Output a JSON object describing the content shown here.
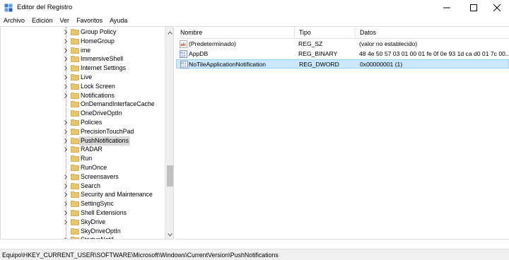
{
  "window": {
    "title": "Editor del Registro"
  },
  "menu": {
    "items": [
      "Archivo",
      "Edición",
      "Ver",
      "Favoritos",
      "Ayuda"
    ]
  },
  "tree": {
    "items": [
      {
        "label": "Group Policy",
        "expandable": true
      },
      {
        "label": "HomeGroup",
        "expandable": true
      },
      {
        "label": "ime",
        "expandable": true
      },
      {
        "label": "ImmersiveShell",
        "expandable": true
      },
      {
        "label": "Internet Settings",
        "expandable": true
      },
      {
        "label": "Live",
        "expandable": true
      },
      {
        "label": "Lock Screen",
        "expandable": true
      },
      {
        "label": "Notifications",
        "expandable": true
      },
      {
        "label": "OnDemandInterfaceCache",
        "expandable": false
      },
      {
        "label": "OneDriveOptIn",
        "expandable": false
      },
      {
        "label": "Policies",
        "expandable": true
      },
      {
        "label": "PrecisionTouchPad",
        "expandable": true
      },
      {
        "label": "PushNotifications",
        "expandable": true,
        "selected": true
      },
      {
        "label": "RADAR",
        "expandable": true
      },
      {
        "label": "Run",
        "expandable": false
      },
      {
        "label": "RunOnce",
        "expandable": false
      },
      {
        "label": "Screensavers",
        "expandable": true
      },
      {
        "label": "Search",
        "expandable": true
      },
      {
        "label": "Security and Maintenance",
        "expandable": true
      },
      {
        "label": "SettingSync",
        "expandable": true
      },
      {
        "label": "Shell Extensions",
        "expandable": true
      },
      {
        "label": "SkyDrive",
        "expandable": true
      },
      {
        "label": "SkyDriveOptIn",
        "expandable": false
      },
      {
        "label": "StartupNotif...",
        "expandable": true
      }
    ]
  },
  "list": {
    "columns": {
      "name": "Nombre",
      "type": "Tipo",
      "data": "Datos"
    },
    "rows": [
      {
        "icon": "string-value-icon",
        "name": "(Predeterminado)",
        "type": "REG_SZ",
        "data": "(valor no establecido)"
      },
      {
        "icon": "binary-value-icon",
        "name": "AppDB",
        "type": "REG_BINARY",
        "data": "48 4e 50 57 03 01 00 01 fe 0f 0e 93 1d ca d0 01 7c 00..."
      },
      {
        "icon": "binary-value-icon",
        "name": "NoTileApplicationNotification",
        "type": "REG_DWORD",
        "data": "0x00000001 (1)",
        "selected": true
      }
    ]
  },
  "status": {
    "path": "Equipo\\HKEY_CURRENT_USER\\SOFTWARE\\Microsoft\\Windows\\CurrentVersion\\PushNotifications"
  },
  "colors": {
    "folder": "#e8c66a",
    "selection": "#cce8ff",
    "selection_border": "#99d1ff",
    "tree_selected": "#d9d9d9"
  }
}
